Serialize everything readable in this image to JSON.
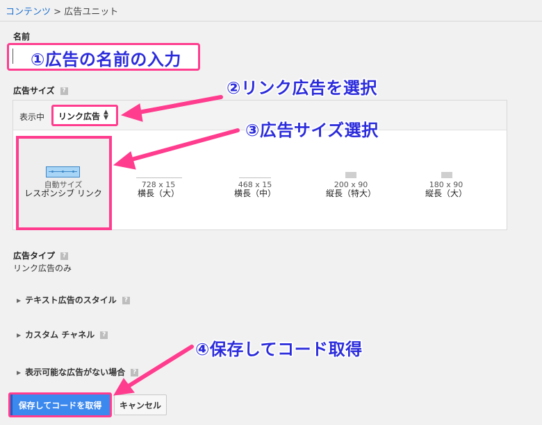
{
  "breadcrumb": {
    "link": "コンテンツ",
    "separator": " > ",
    "current": "広告ユニット"
  },
  "name_section": {
    "label": "名前",
    "annotation": "①広告の名前の入力"
  },
  "size_section": {
    "label": "広告サイズ",
    "help_icon": "?",
    "showing_label": "表示中",
    "select_value": "リンク広告",
    "select_annotation": "②リンク広告を選択",
    "size_annotation": "③広告サイズ選択",
    "selected": {
      "caption1": "自動サイズ",
      "caption2": "レスポンシブ リンク"
    },
    "options": [
      {
        "dim": "728 x 15",
        "name": "横長（大）"
      },
      {
        "dim": "468 x 15",
        "name": "横長（中）"
      },
      {
        "dim": "200 x 90",
        "name": "縦長（特大）"
      },
      {
        "dim": "180 x 90",
        "name": "縦長（大）"
      }
    ]
  },
  "type_section": {
    "label": "広告タイプ",
    "help_icon": "?",
    "value": "リンク広告のみ"
  },
  "accordions": [
    {
      "label": "テキスト広告のスタイル",
      "help_icon": "?"
    },
    {
      "label": "カスタム チャネル",
      "help_icon": "?"
    },
    {
      "label": "表示可能な広告がない場合",
      "help_icon": "?"
    }
  ],
  "actions": {
    "save_label": "保存してコードを取得",
    "cancel_label": "キャンセル",
    "save_annotation": "④保存してコード取得"
  },
  "colors": {
    "highlight": "#ff3c8e",
    "annotation_text": "#2b2bdc",
    "primary_button": "#3b88ee"
  }
}
